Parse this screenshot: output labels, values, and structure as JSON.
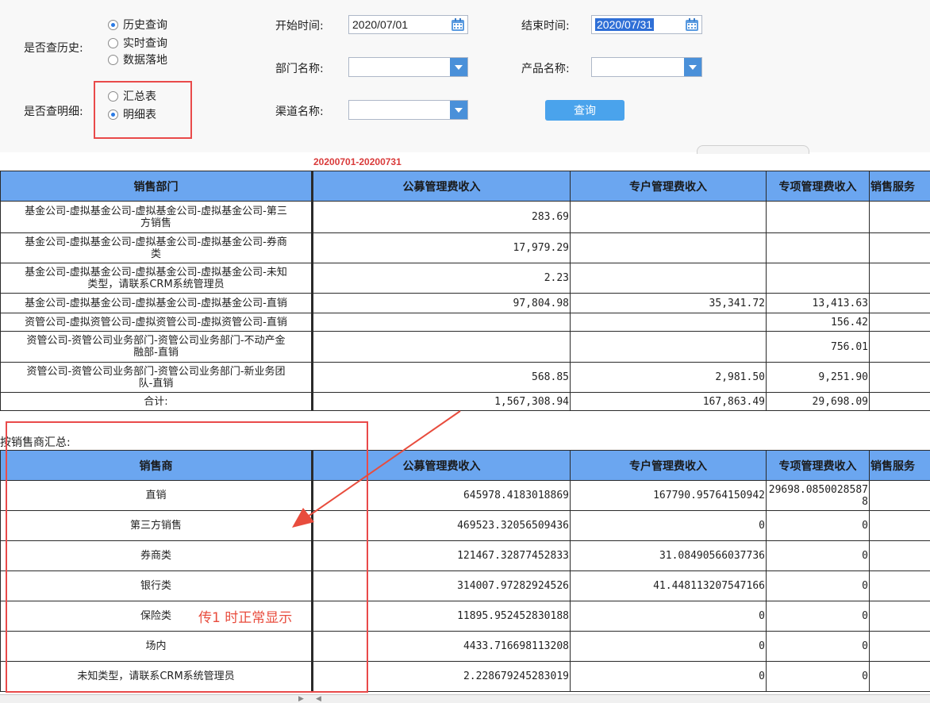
{
  "filters": {
    "history_label": "是否查历史:",
    "history_options": [
      {
        "label": "历史查询",
        "checked": true
      },
      {
        "label": "实时查询",
        "checked": false
      },
      {
        "label": "数据落地",
        "checked": false
      }
    ],
    "detail_label": "是否查明细:",
    "detail_options": [
      {
        "label": "汇总表",
        "checked": false
      },
      {
        "label": "明细表",
        "checked": true
      }
    ],
    "start_label": "开始时间:",
    "start_value": "2020/07/01",
    "end_label": "结束时间:",
    "end_value": "2020/07/31",
    "dept_label": "部门名称:",
    "dept_value": "",
    "product_label": "产品名称:",
    "product_value": "",
    "channel_label": "渠道名称:",
    "channel_value": "",
    "query_button": "查询"
  },
  "date_range": "20200701-20200731",
  "table1": {
    "headers": [
      "销售部门",
      "公募管理费收入",
      "专户管理费收入",
      "专项管理费收入",
      "销售服务"
    ],
    "rows": [
      {
        "dept": "基金公司-虚拟基金公司-虚拟基金公司-虚拟基金公司-第三\n方销售",
        "c1": "283.69",
        "c2": "",
        "c3": ""
      },
      {
        "dept": "基金公司-虚拟基金公司-虚拟基金公司-虚拟基金公司-券商\n类",
        "c1": "17,979.29",
        "c2": "",
        "c3": ""
      },
      {
        "dept": "基金公司-虚拟基金公司-虚拟基金公司-虚拟基金公司-未知\n类型，请联系CRM系统管理员",
        "c1": "2.23",
        "c2": "",
        "c3": ""
      },
      {
        "dept": "基金公司-虚拟基金公司-虚拟基金公司-虚拟基金公司-直销",
        "c1": "97,804.98",
        "c2": "35,341.72",
        "c3": "13,413.63"
      },
      {
        "dept": "资管公司-虚拟资管公司-虚拟资管公司-虚拟资管公司-直销",
        "c1": "",
        "c2": "",
        "c3": "156.42"
      },
      {
        "dept": "资管公司-资管公司业务部门-资管公司业务部门-不动产金\n融部-直销",
        "c1": "",
        "c2": "",
        "c3": "756.01"
      },
      {
        "dept": "资管公司-资管公司业务部门-资管公司业务部门-新业务团\n队-直销",
        "c1": "568.85",
        "c2": "2,981.50",
        "c3": "9,251.90"
      }
    ],
    "total_label": "合计:",
    "totals": [
      "1,567,308.94",
      "167,863.49",
      "29,698.09"
    ]
  },
  "table2_title": "按销售商汇总:",
  "table2": {
    "headers": [
      "销售商",
      "公募管理费收入",
      "专户管理费收入",
      "专项管理费收入",
      "销售服务"
    ],
    "rows": [
      {
        "name": "直销",
        "c1": "645978.4183018869",
        "c2": "167790.95764150942",
        "c3": "29698.08500285878"
      },
      {
        "name": "第三方销售",
        "c1": "469523.32056509436",
        "c2": "0",
        "c3": "0"
      },
      {
        "name": "券商类",
        "c1": "121467.32877452833",
        "c2": "31.08490566037736",
        "c3": "0"
      },
      {
        "name": "银行类",
        "c1": "314007.97282924526",
        "c2": "41.448113207547166",
        "c3": "0"
      },
      {
        "name": "保险类",
        "c1": "11895.952452830188",
        "c2": "0",
        "c3": "0"
      },
      {
        "name": "场内",
        "c1": "4433.716698113208",
        "c2": "0",
        "c3": "0"
      },
      {
        "name": "未知类型，请联系CRM系统管理员",
        "c1": "2.228679245283019",
        "c2": "0",
        "c3": "0"
      }
    ]
  },
  "annotation": "传1 时正常显示",
  "colors": {
    "header_bg": "#6ba6f0",
    "button_bg": "#4aa3ec",
    "annotation": "#e84c3d",
    "date_range": "#d93a3a"
  }
}
